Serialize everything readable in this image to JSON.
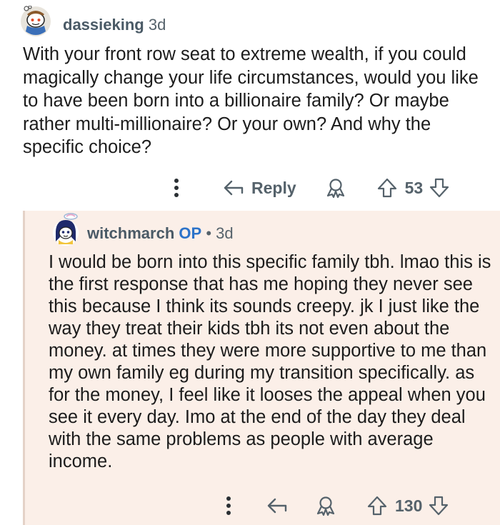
{
  "parent_comment": {
    "username": "dassieking",
    "age": "3d",
    "body": "With your front row seat to extreme wealth, if you could magically change your life circumstances, would you like to have been born into a billionaire family? Or maybe rather multi-millionaire? Or your own? And why the specific choice?",
    "actions": {
      "reply_label": "Reply",
      "score": "53"
    }
  },
  "reply_comment": {
    "username": "witchmarch",
    "op_badge": "OP",
    "separator": "•",
    "age": "3d",
    "body": "I would be born into this specific family tbh. lmao this is the first response that has me hoping they never see this because I think its sounds creepy. jk I just like the way they treat their kids tbh its not even about the money. at times they were more supportive to me than my own family eg during my transition specifically. as for the money, I feel like it looses the appeal when you see it every day. Imo at the end of the day they deal with the same problems as people with average income.",
    "actions": {
      "score": "130"
    }
  },
  "colors": {
    "reply_background": "#fbefe8",
    "thread_line": "#e4d2c7",
    "op_badge": "#2c73c9",
    "action_gray": "#55626b"
  },
  "icons": [
    "more-options-icon",
    "reply-arrow-icon",
    "award-icon",
    "upvote-icon",
    "downvote-icon"
  ]
}
